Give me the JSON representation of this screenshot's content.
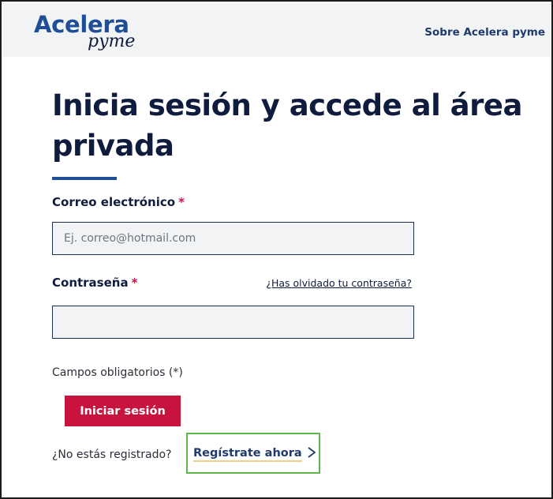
{
  "header": {
    "logo": {
      "main": "Acelera",
      "sub": "pyme"
    },
    "nav_link": "Sobre Acelera pyme"
  },
  "main": {
    "title": "Inicia sesión y accede al área privada",
    "email": {
      "label": "Correo electrónico",
      "required_mark": "*",
      "placeholder": "Ej. correo@hotmail.com",
      "value": ""
    },
    "password": {
      "label": "Contraseña",
      "required_mark": "*",
      "forgot_link": "¿Has olvidado tu contraseña?",
      "value": ""
    },
    "required_note": "Campos obligatorios (*)",
    "login_button": "Iniciar sesión",
    "register": {
      "prompt": "¿No estás registrado?",
      "link": "Regístrate ahora"
    }
  },
  "colors": {
    "brand_blue": "#1f4e99",
    "navy_text": "#101c3d",
    "primary_button": "#c8133f",
    "required_mark": "#d0104c",
    "highlight_box": "#5cb84a"
  },
  "icons": {
    "register_chevron": "chevron-right-icon"
  }
}
